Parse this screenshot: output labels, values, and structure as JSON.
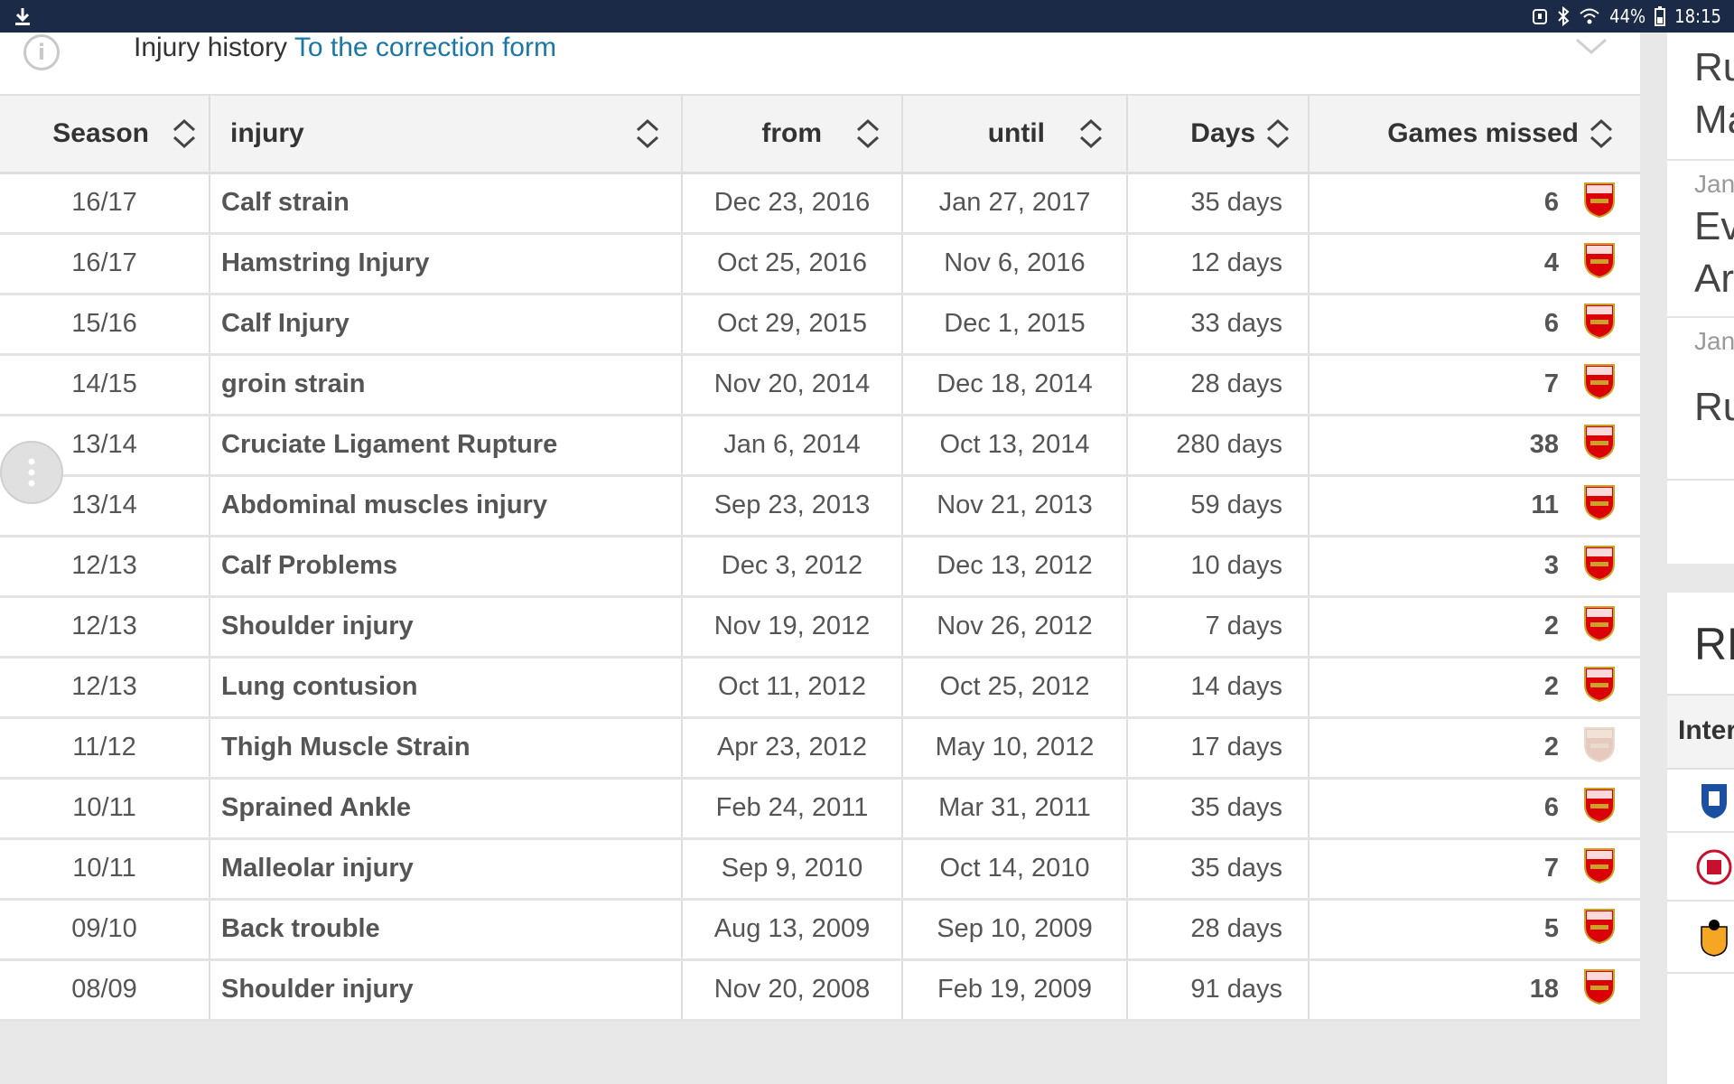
{
  "status": {
    "battery": "44%",
    "time": "18:15"
  },
  "info": {
    "title": "Injury history",
    "link": "To the correction form"
  },
  "headers": {
    "season": "Season",
    "injury": "injury",
    "from": "from",
    "until": "until",
    "days": "Days",
    "games": "Games missed"
  },
  "rows": [
    {
      "season": "16/17",
      "injury": "Calf strain",
      "from": "Dec 23, 2016",
      "until": "Jan 27, 2017",
      "days": "35 days",
      "games": "6",
      "club": "arsenal"
    },
    {
      "season": "16/17",
      "injury": "Hamstring Injury",
      "from": "Oct 25, 2016",
      "until": "Nov 6, 2016",
      "days": "12 days",
      "games": "4",
      "club": "arsenal"
    },
    {
      "season": "15/16",
      "injury": "Calf Injury",
      "from": "Oct 29, 2015",
      "until": "Dec 1, 2015",
      "days": "33 days",
      "games": "6",
      "club": "arsenal"
    },
    {
      "season": "14/15",
      "injury": "groin strain",
      "from": "Nov 20, 2014",
      "until": "Dec 18, 2014",
      "days": "28 days",
      "games": "7",
      "club": "arsenal"
    },
    {
      "season": "13/14",
      "injury": "Cruciate Ligament Rupture",
      "from": "Jan 6, 2014",
      "until": "Oct 13, 2014",
      "days": "280 days",
      "games": "38",
      "club": "arsenal"
    },
    {
      "season": "13/14",
      "injury": "Abdominal muscles injury",
      "from": "Sep 23, 2013",
      "until": "Nov 21, 2013",
      "days": "59 days",
      "games": "11",
      "club": "arsenal"
    },
    {
      "season": "12/13",
      "injury": "Calf Problems",
      "from": "Dec 3, 2012",
      "until": "Dec 13, 2012",
      "days": "10 days",
      "games": "3",
      "club": "arsenal"
    },
    {
      "season": "12/13",
      "injury": "Shoulder injury",
      "from": "Nov 19, 2012",
      "until": "Nov 26, 2012",
      "days": "7 days",
      "games": "2",
      "club": "arsenal"
    },
    {
      "season": "12/13",
      "injury": "Lung contusion",
      "from": "Oct 11, 2012",
      "until": "Oct 25, 2012",
      "days": "14 days",
      "games": "2",
      "club": "arsenal"
    },
    {
      "season": "11/12",
      "injury": "Thigh Muscle Strain",
      "from": "Apr 23, 2012",
      "until": "May 10, 2012",
      "days": "17 days",
      "games": "2",
      "club": "arsenal-faded"
    },
    {
      "season": "10/11",
      "injury": "Sprained Ankle",
      "from": "Feb 24, 2011",
      "until": "Mar 31, 2011",
      "days": "35 days",
      "games": "6",
      "club": "arsenal"
    },
    {
      "season": "10/11",
      "injury": "Malleolar injury",
      "from": "Sep 9, 2010",
      "until": "Oct 14, 2010",
      "days": "35 days",
      "games": "7",
      "club": "arsenal"
    },
    {
      "season": "09/10",
      "injury": "Back trouble",
      "from": "Aug 13, 2009",
      "until": "Sep 10, 2009",
      "days": "28 days",
      "games": "5",
      "club": "arsenal"
    },
    {
      "season": "08/09",
      "injury": "Shoulder injury",
      "from": "Nov 20, 2008",
      "until": "Feb 19, 2009",
      "days": "91 days",
      "games": "18",
      "club": "arsenal"
    }
  ],
  "sidebar": {
    "items": [
      {
        "month": "Jan",
        "line1": "Ru",
        "line2": "Ma"
      },
      {
        "month": "Jan",
        "line1": "Eve",
        "line2": "Ars"
      },
      {
        "month": "Jan",
        "line1": "Ru",
        "line2": ""
      }
    ],
    "section_title": "RE",
    "section_sub": "Inter"
  },
  "colors": {
    "statusbar": "#1b2a47",
    "link": "#1a77a6",
    "arsenal_red": "#db0007"
  }
}
